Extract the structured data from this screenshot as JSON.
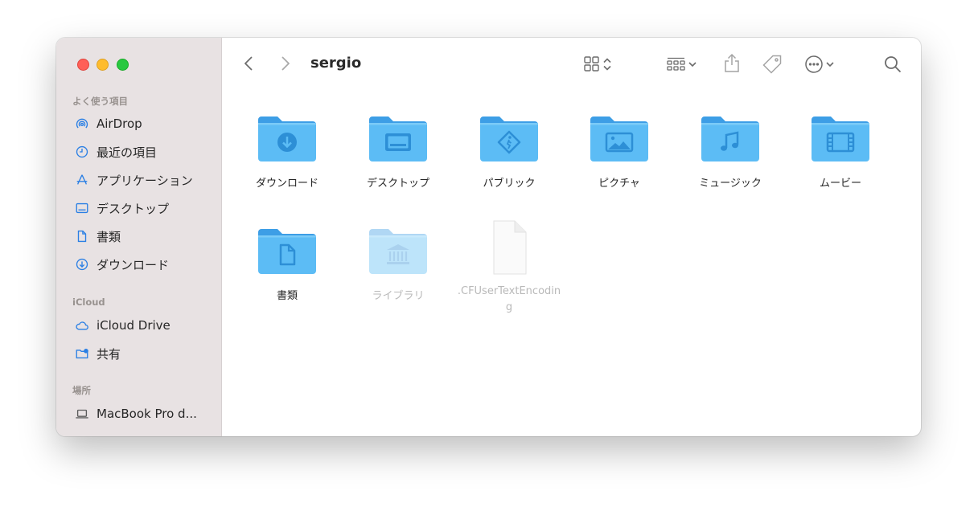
{
  "window": {
    "title": "sergio"
  },
  "sidebar": {
    "sections": [
      {
        "heading": "よく使う項目",
        "items": [
          {
            "label": "AirDrop",
            "icon": "airdrop-icon"
          },
          {
            "label": "最近の項目",
            "icon": "clock-icon"
          },
          {
            "label": "アプリケーション",
            "icon": "applications-icon"
          },
          {
            "label": "デスクトップ",
            "icon": "desktop-icon"
          },
          {
            "label": "書類",
            "icon": "document-icon"
          },
          {
            "label": "ダウンロード",
            "icon": "download-icon"
          }
        ]
      },
      {
        "heading": "iCloud",
        "items": [
          {
            "label": "iCloud Drive",
            "icon": "cloud-icon"
          },
          {
            "label": "共有",
            "icon": "shared-folder-icon"
          }
        ]
      },
      {
        "heading": "場所",
        "items": [
          {
            "label": "MacBook Pro d...",
            "icon": "laptop-icon"
          }
        ]
      }
    ]
  },
  "toolbar": {
    "back_icon": "chevron-left-icon",
    "forward_icon": "chevron-right-icon",
    "view_icon": "icon-grid-icon",
    "group_icon": "group-grid-icon",
    "share_icon": "share-icon",
    "tag_icon": "tag-icon",
    "more_icon": "ellipsis-circle-icon",
    "search_icon": "search-icon"
  },
  "files": [
    {
      "name": "ダウンロード",
      "icon": "download-folder-icon",
      "dimmed": false
    },
    {
      "name": "デスクトップ",
      "icon": "desktop-folder-icon",
      "dimmed": false
    },
    {
      "name": "パブリック",
      "icon": "public-folder-icon",
      "dimmed": false
    },
    {
      "name": "ピクチャ",
      "icon": "pictures-folder-icon",
      "dimmed": false
    },
    {
      "name": "ミュージック",
      "icon": "music-folder-icon",
      "dimmed": false
    },
    {
      "name": "ムービー",
      "icon": "movies-folder-icon",
      "dimmed": false
    },
    {
      "name": "書類",
      "icon": "documents-folder-icon",
      "dimmed": false
    },
    {
      "name": "ライブラリ",
      "icon": "library-folder-icon",
      "dimmed": true
    },
    {
      "name": ".CFUserTextEncoding",
      "icon": "file-icon",
      "dimmed": true
    }
  ],
  "colors": {
    "sidebar_bg": "#e8e2e3",
    "accent": "#2a7fe4",
    "folder_blue": "#5bbcf5"
  }
}
